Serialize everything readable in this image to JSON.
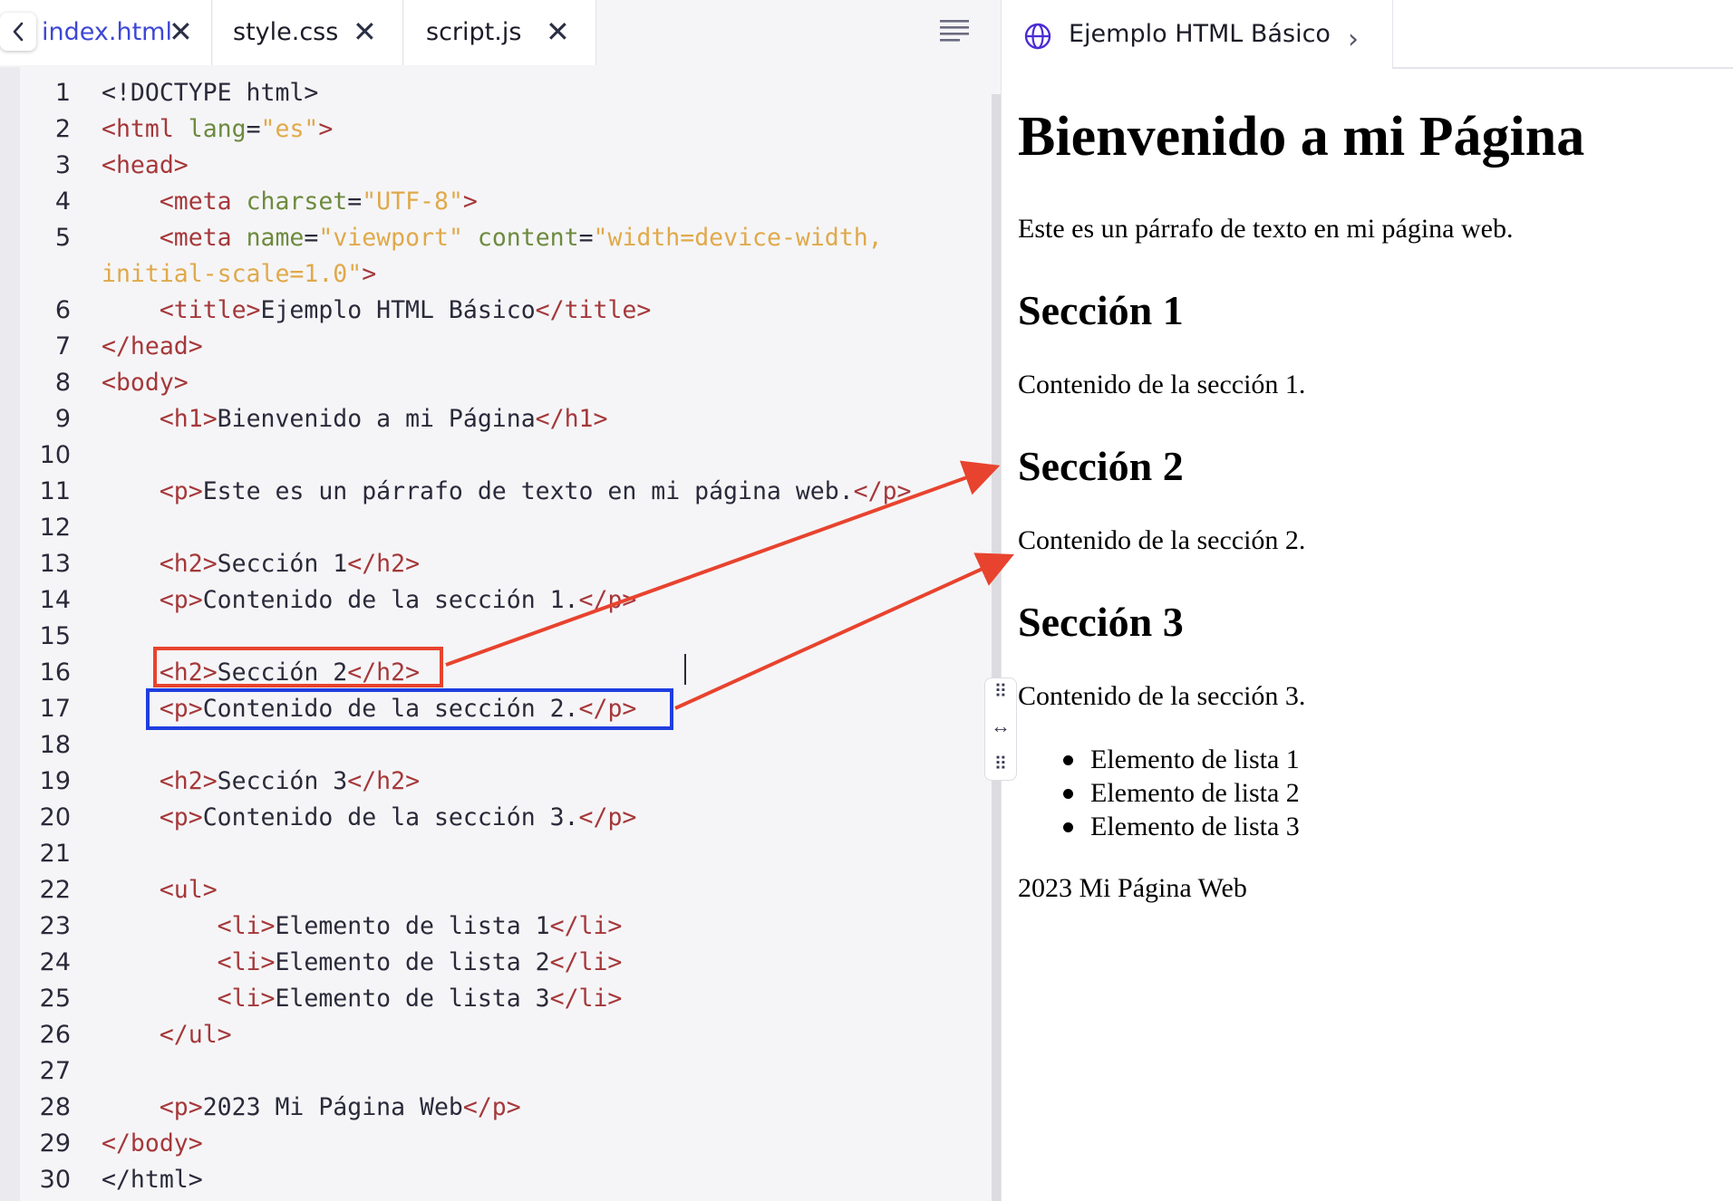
{
  "editor": {
    "tabs": [
      {
        "label": "index.html",
        "active": true
      },
      {
        "label": "style.css",
        "active": false
      },
      {
        "label": "script.js",
        "active": false
      }
    ],
    "close_glyph": "✕",
    "icons": {
      "back": "chevron-left-icon",
      "format": "align-lines-icon"
    },
    "line_numbers": [
      "1",
      "2",
      "3",
      "4",
      "5",
      "6",
      "7",
      "8",
      "9",
      "10",
      "11",
      "12",
      "13",
      "14",
      "15",
      "16",
      "17",
      "18",
      "19",
      "20",
      "21",
      "22",
      "23",
      "24",
      "25",
      "26",
      "27",
      "28",
      "29",
      "30"
    ],
    "code": {
      "l1_text": "<!DOCTYPE html>",
      "l2_tag_open": "<html ",
      "l2_attr": "lang",
      "l2_eq": "=",
      "l2_val": "\"es\"",
      "l2_tag_close": ">",
      "l3_tag": "<head>",
      "l4_tag_open": "<meta ",
      "l4_attr": "charset",
      "l4_eq": "=",
      "l4_val": "\"UTF-8\"",
      "l4_tag_close": ">",
      "l5_tag_open": "<meta ",
      "l5_attr1": "name",
      "l5_eq1": "=",
      "l5_val1": "\"viewport\"",
      "l5_sp": " ",
      "l5_attr2": "content",
      "l5_eq2": "=",
      "l5_val2a": "\"width=device-width,",
      "l5_val2b": "initial-scale=1.0\"",
      "l5_tag_close": ">",
      "l6_open": "<title>",
      "l6_text": "Ejemplo HTML Básico",
      "l6_close": "</title>",
      "l7_text": "</head>",
      "l8_tag": "<body>",
      "l9_open": "<h1>",
      "l9_text": "Bienvenido a mi Página",
      "l9_close": "</h1>",
      "l11_open": "<p>",
      "l11_text": "Este es un párrafo de texto en mi página web.",
      "l11_close": "</p>",
      "l13_open": "<h2>",
      "l13_text": "Sección 1",
      "l13_close": "</h2>",
      "l14_open": "<p>",
      "l14_text": "Contenido de la sección 1.",
      "l14_close": "</p>",
      "l16_open": "<h2>",
      "l16_text": "Sección 2",
      "l16_close": "</h2>",
      "l17_open": "<p>",
      "l17_text": "Contenido de la sección 2.",
      "l17_close": "</p>",
      "l19_open": "<h2>",
      "l19_text": "Sección 3",
      "l19_close": "</h2>",
      "l20_open": "<p>",
      "l20_text": "Contenido de la sección 3.",
      "l20_close": "</p>",
      "l22_tag": "<ul>",
      "l23_open": "<li>",
      "l23_text": "Elemento de lista 1",
      "l23_close": "</li>",
      "l24_open": "<li>",
      "l24_text": "Elemento de lista 2",
      "l24_close": "</li>",
      "l25_open": "<li>",
      "l25_text": "Elemento de lista 3",
      "l25_close": "</li>",
      "l26_tag": "</ul>",
      "l28_open": "<p>",
      "l28_text": "2023 Mi Página Web",
      "l28_close": "</p>",
      "l29_tag": "</body>",
      "l30_text": "</html>"
    }
  },
  "splitter": {
    "top_glyph": "⠿",
    "mid_glyph": "↔",
    "bottom_glyph": "⠿"
  },
  "preview": {
    "tab_title": "Ejemplo HTML Básico",
    "chevron": "›",
    "h1": "Bienvenido a mi Página",
    "intro": "Este es un párrafo de texto en mi página web.",
    "sections": [
      {
        "heading": "Sección 1",
        "body": "Contenido de la sección 1."
      },
      {
        "heading": "Sección 2",
        "body": "Contenido de la sección 2."
      },
      {
        "heading": "Sección 3",
        "body": "Contenido de la sección 3."
      }
    ],
    "list": [
      "Elemento de lista 1",
      "Elemento de lista 2",
      "Elemento de lista 3"
    ],
    "footer": "2023 Mi Página Web"
  },
  "colors": {
    "tag": "#a5383a",
    "attr": "#6d8a3e",
    "string": "#e0a94a",
    "text": "#2a2a3a",
    "active_tab": "#3d47d6",
    "annotation_red": "#e8432e",
    "annotation_blue": "#1f3ee0"
  }
}
